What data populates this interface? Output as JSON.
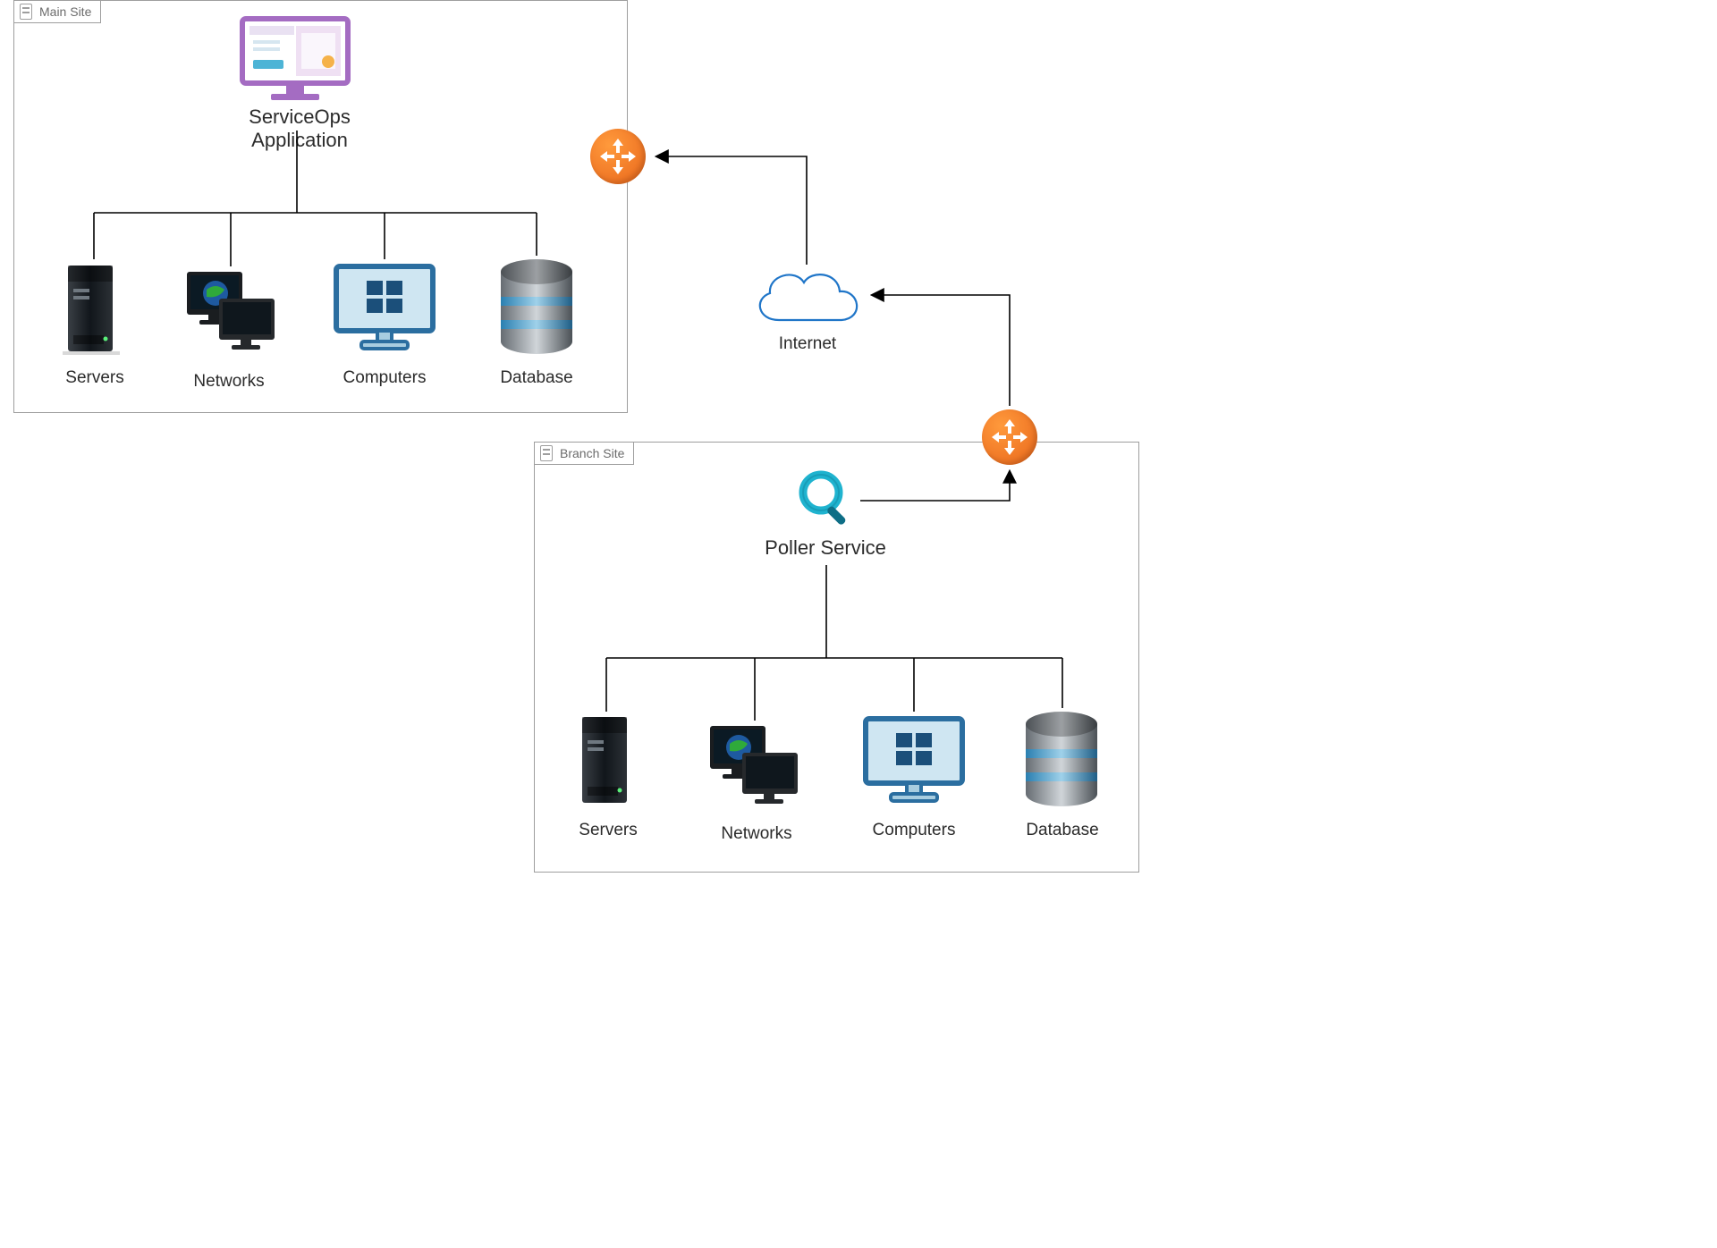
{
  "main_site": {
    "title": "Main Site",
    "app_label": "ServiceOps Application",
    "children": [
      "Servers",
      "Networks",
      "Computers",
      "Database"
    ]
  },
  "branch_site": {
    "title": "Branch Site",
    "app_label": "Poller Service",
    "children": [
      "Servers",
      "Networks",
      "Computers",
      "Database"
    ]
  },
  "internet_label": "Internet",
  "colors": {
    "router": "#f07a28",
    "cloud_stroke": "#1f75c8",
    "box_border": "#9e9e9e"
  }
}
